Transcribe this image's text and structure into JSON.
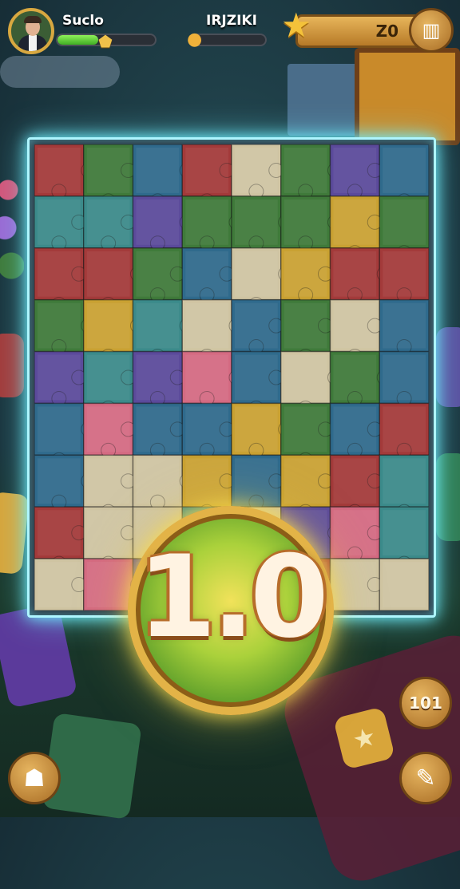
{
  "hud": {
    "player_name": "Suclo",
    "xp_progress": 0.42,
    "resource_label": "IRJZIKI",
    "resource_progress": 0.12,
    "score": "Z0",
    "menu_icon": "menu-icon",
    "star_icon": "star-icon"
  },
  "board": {
    "rows": 9,
    "cols": 8,
    "palette": [
      "#2f6a8c",
      "#3f7a3a",
      "#c9a132",
      "#a33a3a",
      "#5b4a9b",
      "#cfc4a2",
      "#d46a82",
      "#3b8a8a"
    ]
  },
  "center_coin": {
    "value": "1.0"
  },
  "buttons": {
    "counter_label": "101",
    "hint_icon": "ribbon-icon",
    "pencil_icon": "pencil-icon"
  }
}
